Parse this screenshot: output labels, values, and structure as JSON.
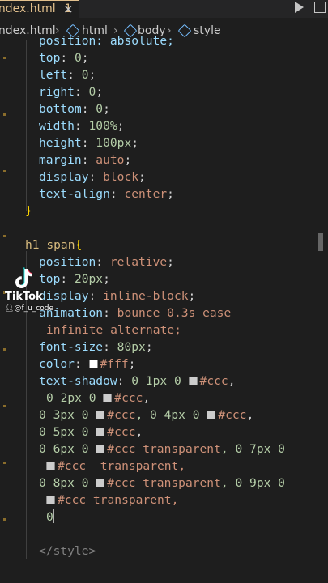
{
  "tab": {
    "filename": "index.html",
    "problem_count": "1",
    "close": "×"
  },
  "breadcrumb": {
    "file": "index.html",
    "items": [
      "html",
      "body",
      "style"
    ],
    "separator": "›"
  },
  "code": {
    "l0": "position: absolute;",
    "l1": [
      "top",
      "0"
    ],
    "l2": [
      "left",
      "0"
    ],
    "l3": [
      "right",
      "0"
    ],
    "l4": [
      "bottom",
      "0"
    ],
    "l5": [
      "width",
      "100%"
    ],
    "l6": [
      "height",
      "100px"
    ],
    "l7": [
      "margin",
      "auto"
    ],
    "l8": [
      "display",
      "block"
    ],
    "l9": [
      "text-align",
      "center"
    ],
    "l10": "}",
    "l12_selector": "h1 span",
    "l12_brace": "{",
    "l13": [
      "position",
      "relative"
    ],
    "l14": [
      "top",
      "20px"
    ],
    "l15": [
      "display",
      "inline-block"
    ],
    "l16": [
      "animation",
      "bounce 0.3s ease"
    ],
    "l17": "infinite alternate;",
    "l18": [
      "font-size",
      "80px"
    ],
    "l19": [
      "color",
      "#fff"
    ],
    "l20": {
      "prop": "text-shadow",
      "a": "0 1px 0 ",
      "c": "#ccc"
    },
    "l21": {
      "a": "0 2px 0 ",
      "c": "#ccc"
    },
    "l22": {
      "a": "0 3px 0 ",
      "c1": "#ccc",
      "b": ", 0 4px 0 ",
      "c2": "#ccc"
    },
    "l23": {
      "a": "0 5px 0 ",
      "c": "#ccc"
    },
    "l24": {
      "a": "0 6px 0 ",
      "c": "#ccc transparent",
      "b": ", 0 7px 0"
    },
    "l25": {
      "c": "#ccc  transparent,"
    },
    "l26": {
      "a": "0 8px 0 ",
      "c": "#ccc transparent",
      "b": ", 0 9px 0"
    },
    "l27": {
      "c": "#ccc transparent,"
    },
    "l28": "0",
    "l31": "</style>"
  },
  "watermark": {
    "brand": "TikTok",
    "user": "@f_u_code"
  },
  "colors": {
    "swatch_white": "#ffffff",
    "swatch_grey": "#cccccc"
  }
}
